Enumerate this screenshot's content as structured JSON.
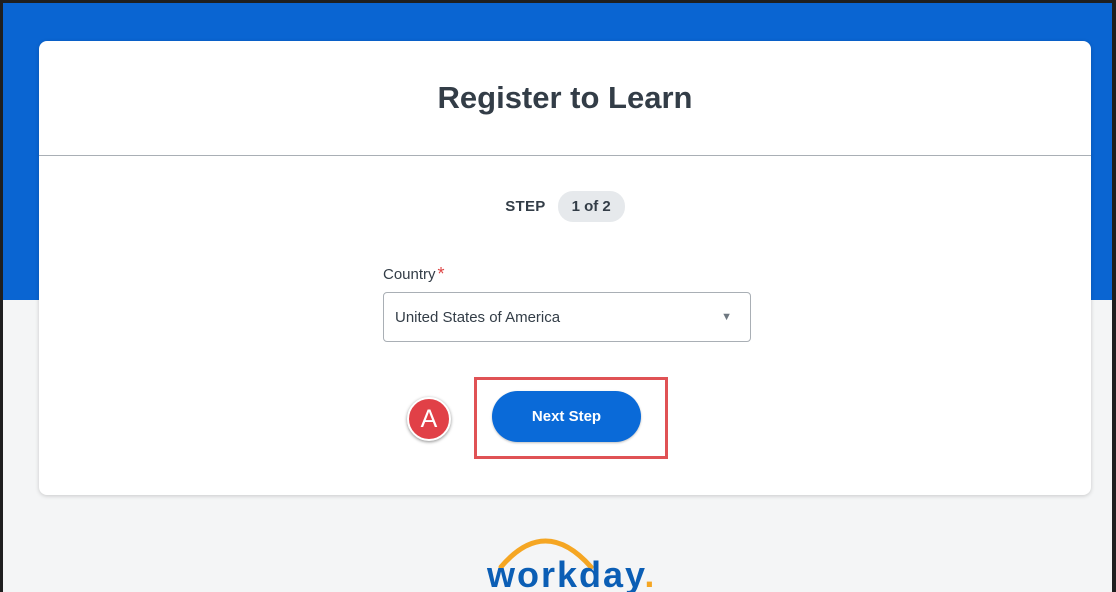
{
  "card": {
    "title": "Register to Learn",
    "step_label": "STEP",
    "step_value": "1 of 2"
  },
  "form": {
    "country_label": "Country",
    "required_mark": "*",
    "country_value": "United States of America",
    "dropdown_icon": "triangle-down-icon"
  },
  "actions": {
    "next_label": "Next Step"
  },
  "annotation": {
    "marker_letter": "A",
    "highlight_color": "#e05255",
    "marker_color": "#e14047"
  },
  "logo": {
    "text": "workday",
    "dot": ".",
    "brand_blue": "#0b5eb5",
    "brand_orange": "#f5a623"
  },
  "colors": {
    "header_blue": "#0a65d2",
    "button_blue": "#0a6ad8",
    "page_background": "#f4f5f6"
  }
}
